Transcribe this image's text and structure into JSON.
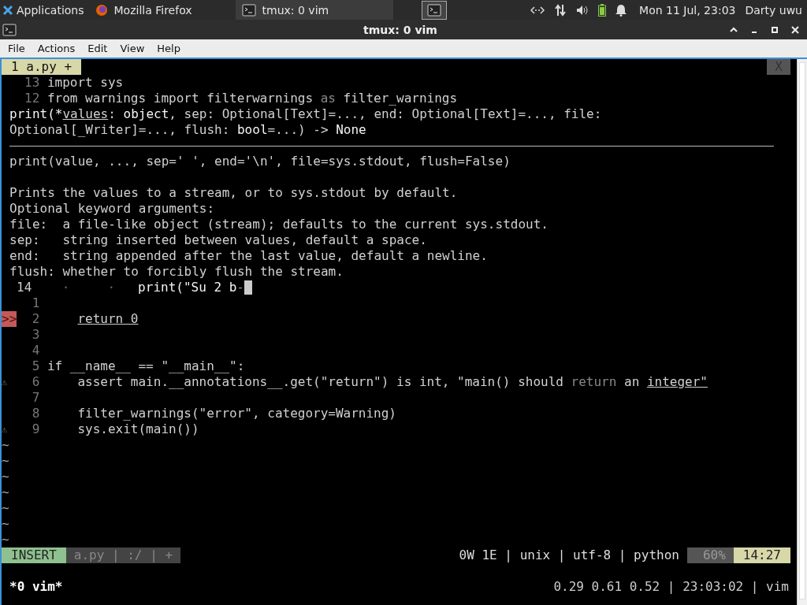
{
  "taskbar": {
    "apps_menu": "Applications",
    "tasks": [
      {
        "kind": "firefox",
        "title": "Mozilla Firefox",
        "selected": false
      },
      {
        "kind": "terminal",
        "title": "tmux: 0 vim",
        "selected": true
      }
    ],
    "clock": "Mon 11 Jul, 23:03",
    "user": "Darty uwu"
  },
  "window": {
    "title": "tmux: 0 vim",
    "menu": [
      "File",
      "Actions",
      "Edit",
      "View",
      "Help"
    ]
  },
  "vim": {
    "tabs": [
      {
        "label": "1 a.py +",
        "selected": true
      }
    ],
    "close": "X",
    "rows": [
      {
        "kind": "code",
        "number": "13",
        "segments": [
          {
            "kind": "plain",
            "text": "import sys"
          }
        ]
      },
      {
        "kind": "code",
        "number": "12",
        "segments": [
          {
            "kind": "plain",
            "text": "from warnings import filterwarnings "
          },
          {
            "kind": "dim",
            "text": "as"
          },
          {
            "kind": "plain",
            "text": " filter_warnings"
          }
        ]
      },
      {
        "kind": "doc",
        "segments": [
          {
            "kind": "bright",
            "text": "print(*"
          },
          {
            "kind": "underline",
            "text": "values"
          },
          {
            "kind": "plain",
            "text": ": "
          },
          {
            "kind": "bright",
            "text": "object"
          },
          {
            "kind": "plain",
            "text": ", sep: Optional[Text]=..., end: Optional[Text]=..., file:"
          }
        ]
      },
      {
        "kind": "doc",
        "segments": [
          {
            "kind": "plain",
            "text": "Optional[_Writer]=..., flush: "
          },
          {
            "kind": "bright",
            "text": "bool"
          },
          {
            "kind": "plain",
            "text": "=...) -> "
          },
          {
            "kind": "bright",
            "text": "None"
          }
        ]
      },
      {
        "kind": "rule"
      },
      {
        "kind": "doc",
        "segments": [
          {
            "kind": "plain",
            "text": "print(value, ..., sep=' ', end='\\n', file=sys.stdout, flush=False)"
          }
        ]
      },
      {
        "kind": "blank"
      },
      {
        "kind": "doc",
        "segments": [
          {
            "kind": "plain",
            "text": "Prints the values to a stream, or to sys.stdout by default."
          }
        ]
      },
      {
        "kind": "doc",
        "segments": [
          {
            "kind": "plain",
            "text": "Optional keyword arguments:"
          }
        ]
      },
      {
        "kind": "doc",
        "segments": [
          {
            "kind": "plain",
            "text": "file:  a file-like object (stream); defaults to the current sys.stdout."
          }
        ]
      },
      {
        "kind": "doc",
        "segments": [
          {
            "kind": "plain",
            "text": "sep:   string inserted between values, default a space."
          }
        ]
      },
      {
        "kind": "doc",
        "segments": [
          {
            "kind": "plain",
            "text": "end:   string appended after the last value, default a newline."
          }
        ]
      },
      {
        "kind": "doc",
        "segments": [
          {
            "kind": "plain",
            "text": "flush: whether to forcibly flush the stream."
          }
        ]
      },
      {
        "kind": "code",
        "number": "14",
        "current": true,
        "cursor": true,
        "segments": [
          {
            "kind": "guide",
            "text": "  ·     ·   "
          },
          {
            "kind": "bright",
            "text": "print(\"Su 2 b"
          },
          {
            "kind": "dim",
            "text": "-"
          }
        ]
      },
      {
        "kind": "code",
        "number": "1"
      },
      {
        "kind": "code",
        "number": "2",
        "sign": {
          "kind": "error",
          "text": ">>"
        },
        "segments": [
          {
            "kind": "underline",
            "indent": true,
            "text": "return 0"
          }
        ]
      },
      {
        "kind": "code",
        "number": "3"
      },
      {
        "kind": "code",
        "number": "4"
      },
      {
        "kind": "code",
        "number": "5",
        "segments": [
          {
            "kind": "plain",
            "text": "if __name__ == \"__main__\":"
          }
        ]
      },
      {
        "kind": "code",
        "number": "6",
        "sign": {
          "kind": "warning",
          "text": "⚠"
        },
        "segments": [
          {
            "kind": "plain",
            "text": "    assert main.__annotations__.get(\"return\") is int, \"main() should "
          },
          {
            "kind": "dim",
            "text": "return"
          },
          {
            "kind": "plain",
            "text": " an "
          },
          {
            "kind": "underline",
            "text": "integer\""
          }
        ]
      },
      {
        "kind": "code",
        "number": "7"
      },
      {
        "kind": "code",
        "number": "8",
        "segments": [
          {
            "kind": "plain",
            "text": "    filter_warnings(\"error\", category=Warning)"
          }
        ]
      },
      {
        "kind": "code",
        "number": "9",
        "sign": {
          "kind": "warning",
          "text": "⚠"
        },
        "segments": [
          {
            "kind": "plain",
            "text": "    sys.exit(main())"
          }
        ]
      },
      {
        "kind": "tilde",
        "text": "~"
      },
      {
        "kind": "tilde",
        "text": "~"
      },
      {
        "kind": "tilde",
        "text": "~"
      },
      {
        "kind": "tilde",
        "text": "~"
      },
      {
        "kind": "tilde",
        "text": "~"
      },
      {
        "kind": "tilde",
        "text": "~"
      },
      {
        "kind": "tilde",
        "text": "~"
      }
    ],
    "statusline": {
      "mode": "INSERT",
      "file": "a.py | :/ | +",
      "info": "0W 1E | unix | utf-8 | python",
      "percent": "60%",
      "position": "14:27"
    }
  },
  "tmux": {
    "window": "*0 vim*",
    "status": "0.29 0.61 0.52 | 23:03:02 | vim"
  }
}
